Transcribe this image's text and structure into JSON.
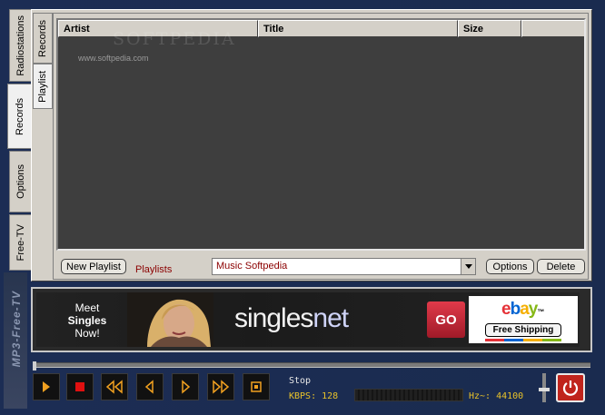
{
  "left_tabs": [
    {
      "label": "Radiostations"
    },
    {
      "label": "Records"
    },
    {
      "label": "Options"
    },
    {
      "label": "Free-TV"
    }
  ],
  "inner_tabs": [
    {
      "label": "Records"
    },
    {
      "label": "Playlist"
    }
  ],
  "table": {
    "columns": [
      "Artist",
      "Title",
      "Size"
    ],
    "rows": []
  },
  "watermark": {
    "main": "SOFTPEDIA",
    "sub": "www.softpedia.com"
  },
  "playlist_bar": {
    "new_playlist_label": "New Playlist",
    "playlists_label": "Playlists",
    "selected_playlist": "Music Softpedia",
    "options_label": "Options",
    "delete_label": "Delete"
  },
  "ad": {
    "meet_lines": [
      "Meet",
      "Singles",
      "Now!"
    ],
    "brand_a": "singles",
    "brand_b": "net",
    "go_label": "GO",
    "ebay_letters": [
      "e",
      "b",
      "a",
      "y"
    ],
    "ebay_tm": "™",
    "shipping_label": "Free Shipping"
  },
  "side_logo": "MP3-Free-TV",
  "status": {
    "state": "Stop",
    "kbps_text": "KBPS: 128",
    "hz_text": "Hz~: 44100"
  },
  "colors": {
    "list_background": "#3e3e3e",
    "status_yellow": "#e8c22a",
    "control_orange": "#f0a020",
    "stop_red": "#e01010",
    "power_red": "#c0241c"
  }
}
